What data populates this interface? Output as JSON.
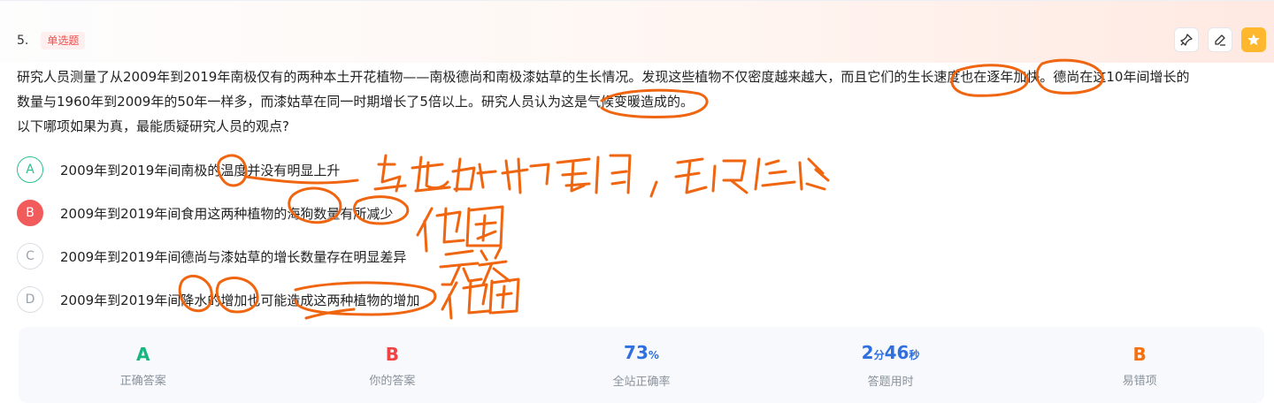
{
  "question": {
    "number": "5.",
    "type_tag": "单选题",
    "stem_line1": "研究人员测量了从2009年到2019年南极仅有的两种本土开花植物——南极德尚和南极漆姑草的生长情况。发现这些植物不仅密度越来越大，而且它们的生长速度也在逐年加快。德尚在这10年间增长的",
    "stem_line2": "数量与1960年到2009年的50年一样多，而漆姑草在同一时期增长了5倍以上。研究人员认为这是气候变暖造成的。",
    "stem_line3": "以下哪项如果为真，最能质疑研究人员的观点?"
  },
  "options": [
    {
      "letter": "A",
      "text": "2009年到2019年间南极的温度并没有明显上升",
      "state": "correct"
    },
    {
      "letter": "B",
      "text": "2009年到2019年间食用这两种植物的海狗数量有所减少",
      "state": "wrong"
    },
    {
      "letter": "C",
      "text": "2009年到2019年间德尚与漆姑草的增长数量存在明显差异",
      "state": "normal"
    },
    {
      "letter": "D",
      "text": "2009年到2019年间降水的增加也可能造成这两种植物的增加",
      "state": "normal"
    }
  ],
  "toolbar": {
    "pin_icon": "pin-icon",
    "edit_icon": "pencil-icon",
    "favorite_icon": "star-icon"
  },
  "stats": {
    "correct_answer": {
      "value": "A",
      "label": "正确答案"
    },
    "your_answer": {
      "value": "B",
      "label": "你的答案"
    },
    "accuracy": {
      "value": "73",
      "unit": "%",
      "label": "全站正确率"
    },
    "time": {
      "min": "2",
      "min_unit": "分",
      "sec": "46",
      "sec_unit": "秒",
      "label": "答题用时"
    },
    "wrong_option": {
      "value": "B",
      "label": "易错项"
    }
  },
  "colors": {
    "correct": "#19b67f",
    "wrong": "#ef4444",
    "blue": "#2f6fdf",
    "orange": "#f7700d",
    "ink": "#f0650f"
  }
}
